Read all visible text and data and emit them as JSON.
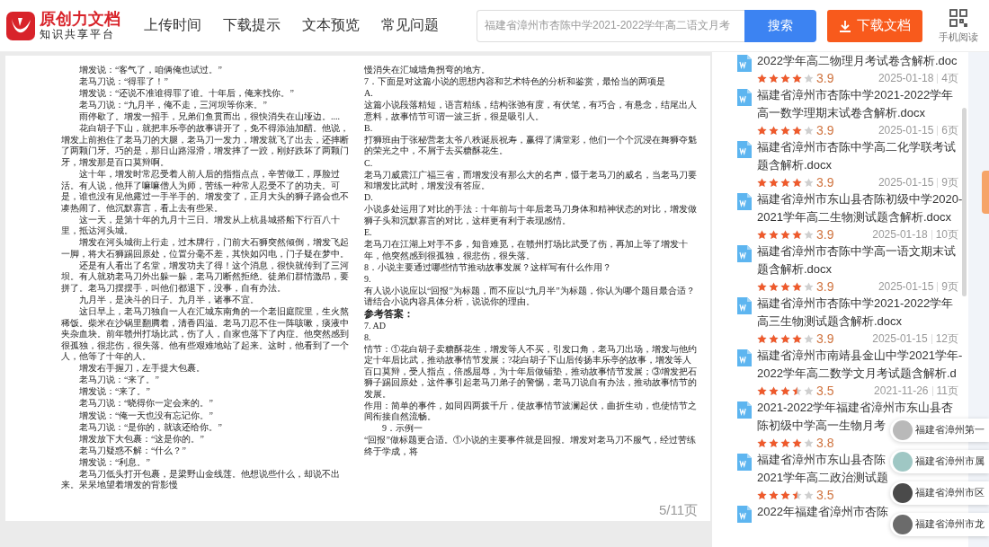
{
  "header": {
    "logo_title": "原创力文档",
    "logo_subtitle": "知识共享平台",
    "nav": [
      "上传时间",
      "下载提示",
      "文本预览",
      "常见问题"
    ],
    "search": {
      "value": "福建省漳州市杏陈中学2021-2022学年高二语文月考",
      "button": "搜索"
    },
    "download_button": "下载文档",
    "mobile_label": "手机阅读"
  },
  "document": {
    "columns": [
      [
        {
          "kind": "indent",
          "text": "增发说：“客气了，咱俩俺也试过。”"
        },
        {
          "kind": "indent",
          "text": "老马刀说：“得罪了！”"
        },
        {
          "kind": "indent",
          "text": "增发说：“还说不准谁得罪了谁。十年后，俺来找你。”"
        },
        {
          "kind": "indent",
          "text": "老马刀说：“九月半，俺不走，三河坝等你来。”"
        },
        {
          "kind": "indent",
          "text": "雨停歇了。增发一招手，兄弟们鱼贯而出，很快消失在山垭边。...."
        },
        {
          "kind": "indent",
          "text": "花白胡子下山，就把丰乐亭的故事讲开了，免不得添油加醋。他说，增发上前抱住了老马刀的大腿，老马刀一发力，增发就飞了出去，还摔断了两颗门牙。巧的是，那日山路湿滑，增发摔了一跤，刚好跌坏了两颗门牙，增发那是百口莫辩啊。"
        },
        {
          "kind": "indent",
          "text": "这十年，增发时常忍受着人前人后的指指点点，辛苦做工，厚脸过活。有人说，他拜了嘛嘛僧人为师，苦练一种常人忍受不了的功夫。可是，谁也没有见他露过一手半手的。增发变了，正月大头的狮子路会也不凑热闹了。他沉默寡言，看上去有些呆。"
        },
        {
          "kind": "indent",
          "text": "这一天，是第十年的九月十三日。增发从上杭县城搭船下行百八十里，抵达河头城。"
        },
        {
          "kind": "indent",
          "text": "增发在河头城街上行走，过木牌行，门前大石狮突然倾倒，增发飞起一脚，将大石狮踢回原处，位置分毫不差，其快如闪电，门子疑在梦中。"
        },
        {
          "kind": "indent",
          "text": "还是有人看出了名堂，增发功夫了得！这个消息，很快就传到了三河坝。有人就劝老马刀外出躲一躲，老马刀断然拒绝。徒弟们群情激昂，要拼了。老马刀摆摆手，叫他们都退下，没事，自有办法。"
        },
        {
          "kind": "indent",
          "text": "九月半，是决斗的日子。九月半，诸事不宜。"
        },
        {
          "kind": "indent",
          "text": "这日早上，老马刀独自一人在汇城东南角的一个老旧庭院里，生火熬稀饭。柴米在沙锅里翻腾着，清香四溢。老马刀忍不住一阵咳嗽，痰液中夹杂血块。前年赣州打场比武，伤了人，自家也落下了内症。他突然感到很孤独，很悲伤，很失落。他有些艰难地站了起来。这时，他看到了一个人，他等了十年的人。"
        },
        {
          "kind": "indent",
          "text": "增发右手握刀，左手提大包裹。"
        },
        {
          "kind": "indent",
          "text": "老马刀说：“来了。”"
        },
        {
          "kind": "indent",
          "text": "增发说：“来了。”"
        },
        {
          "kind": "indent",
          "text": "老马刀说：“晓得你一定会来的。”"
        },
        {
          "kind": "indent",
          "text": "增发说：“俺一天也没有忘记你。”"
        },
        {
          "kind": "indent",
          "text": "老马刀说：“是你的，就该还给你。”"
        },
        {
          "kind": "indent",
          "text": "增发放下大包裹：“这是你的。”"
        },
        {
          "kind": "indent",
          "text": "老马刀疑惑不解：“什么？”"
        },
        {
          "kind": "indent",
          "text": "增发说：“利息。”"
        },
        {
          "kind": "indent",
          "text": "老马刀低头打开包裹，是梁野山金线莲。他想说些什么，却说不出来。呆呆地望着增发的背影慢"
        }
      ],
      [
        {
          "kind": "plain",
          "text": "慢消失在汇城墙角拐弯的地方。"
        },
        {
          "kind": "plain",
          "text": "7．下面是对这篇小说的思想内容和艺术特色的分析和鉴赏，最恰当的两项是"
        },
        {
          "kind": "plain",
          "text": "A."
        },
        {
          "kind": "plain",
          "text": "这篇小说段落精短，语言精练，结构张弛有度，有伏笔，有巧合，有悬念，结尾出人意料，故事情节可谓一波三折，很是吸引人。"
        },
        {
          "kind": "plain",
          "text": "B."
        },
        {
          "kind": "plain",
          "text": "打狮班由于张秘营老太爷八秩诞辰祝寿，赢得了满堂彩，他们一个个沉浸在舞狮夺魁的荣光之中，不屑于去买糖酥花生。"
        },
        {
          "kind": "plain",
          "text": "C."
        },
        {
          "kind": "plain",
          "text": "老马刀威震江广福三省，而增发没有那么大的名声，慑于老马刀的威名，当老马刀要和增发比武时，增发没有答应。"
        },
        {
          "kind": "plain",
          "text": "D."
        },
        {
          "kind": "plain",
          "text": "小说多处运用了对比的手法：十年前与十年后老马刀身体和精神状态的对比，增发做狮子头和沉默寡言的对比，这样更有利于表现感情。"
        },
        {
          "kind": "plain",
          "text": "E."
        },
        {
          "kind": "plain",
          "text": "老马刀在江湖上对手不多，知音难觅，在赣州打场比武受了伤，再加上等了增发十年，他突然感到很孤独，很悲伤，很失落。"
        },
        {
          "kind": "plain",
          "text": "8．小说主要通过哪些情节推动故事发展？这样写有什么作用？"
        },
        {
          "kind": "plain",
          "text": "9."
        },
        {
          "kind": "plain",
          "text": "有人说小说应以“回报”为标题，而不应以“九月半”为标题，你认为哪个题目最合适？请结合小说内容具体分析，说说你的理由。"
        },
        {
          "kind": "bold",
          "text": "参考答案："
        },
        {
          "kind": "plain",
          "text": "7. AD"
        },
        {
          "kind": "plain",
          "text": "8."
        },
        {
          "kind": "plain",
          "text": "情节：①花白胡子卖糖酥花生，增发等人不买，引发口角，老马刀出场，增发与他约定十年后比武，推动故事情节发展；?花白胡子下山后传扬丰乐亭的故事，增发等人百口莫辩，受人指点，倍感屈辱，为十年后做铺垫，推动故事情节发展；③增发把石狮子踢回原处，这件事引起老马刀弟子的警惕，老马刀说自有办法，推动故事情节的发展。"
        },
        {
          "kind": "plain",
          "text": "作用：简单的事件，如同四两拨千斤，使故事情节波澜起伏，曲折生动，也使情节之间衔接自然流畅。"
        },
        {
          "kind": "indent",
          "text": "9．示例一"
        },
        {
          "kind": "plain",
          "text": "“回报”做标题更合适。①小说的主要事件就是回报。增发对老马刀不服气，经过苦练终于学成，将"
        }
      ]
    ],
    "page_counter": "5/11页"
  },
  "sidebar": {
    "items": [
      {
        "title_lines": [
          "2022学年高二物理月考试卷含解析.doc"
        ],
        "stars": 4,
        "rating": "3.9",
        "date": "2025-01-18",
        "pages": "4页"
      },
      {
        "title_lines": [
          "福建省漳州市杏陈中学2021-2022学年",
          "高一数学理期末试卷含解析.docx"
        ],
        "stars": 4,
        "rating": "3.9",
        "date": "2025-01-15",
        "pages": "6页"
      },
      {
        "title_lines": [
          "福建省漳州市杏陈中学高二化学联考试",
          "题含解析.docx"
        ],
        "stars": 4,
        "rating": "3.9",
        "date": "2025-01-15",
        "pages": "9页"
      },
      {
        "title_lines": [
          "福建省漳州市东山县杏陈初级中学2020-",
          "2021学年高二生物测试题含解析.docx"
        ],
        "stars": 4,
        "rating": "3.9",
        "date": "2025-01-18",
        "pages": "10页"
      },
      {
        "title_lines": [
          "福建省漳州市杏陈中学高一语文期末试",
          "题含解析.docx"
        ],
        "stars": 4,
        "rating": "3.9",
        "date": "2025-01-15",
        "pages": "9页"
      },
      {
        "title_lines": [
          "福建省漳州市杏陈中学2021-2022学年",
          "高三生物测试题含解析.docx"
        ],
        "stars": 4,
        "rating": "3.9",
        "date": "2025-01-15",
        "pages": "12页"
      },
      {
        "title_lines": [
          "福建省漳州市南靖县金山中学2021学年-",
          "2022学年高二数学文月考试题含解析.d"
        ],
        "stars": 3.5,
        "rating": "3.5",
        "date": "2021-11-26",
        "pages": "11页"
      },
      {
        "title_lines": [
          "2021-2022学年福建省漳州市东山县杏",
          "陈初级中学高一生物月考"
        ],
        "stars": 4,
        "rating": "3.8"
      },
      {
        "title_lines": [
          "福建省漳州市东山县杏陈",
          "2021学年高二政治测试题"
        ],
        "stars": 3.5,
        "rating": "3.5"
      },
      {
        "title_lines": [
          "2022年福建省漳州市杏陈"
        ]
      }
    ]
  },
  "popup": [
    {
      "text": "福建省漳州第一",
      "color": "#b9b9b9"
    },
    {
      "text": "福建省漳州市属",
      "color": "#9fc7c4"
    },
    {
      "text": "福建省漳州市区",
      "color": "#4a4a4a"
    },
    {
      "text": "福建省漳州市龙",
      "color": "#6b6b6b"
    }
  ]
}
